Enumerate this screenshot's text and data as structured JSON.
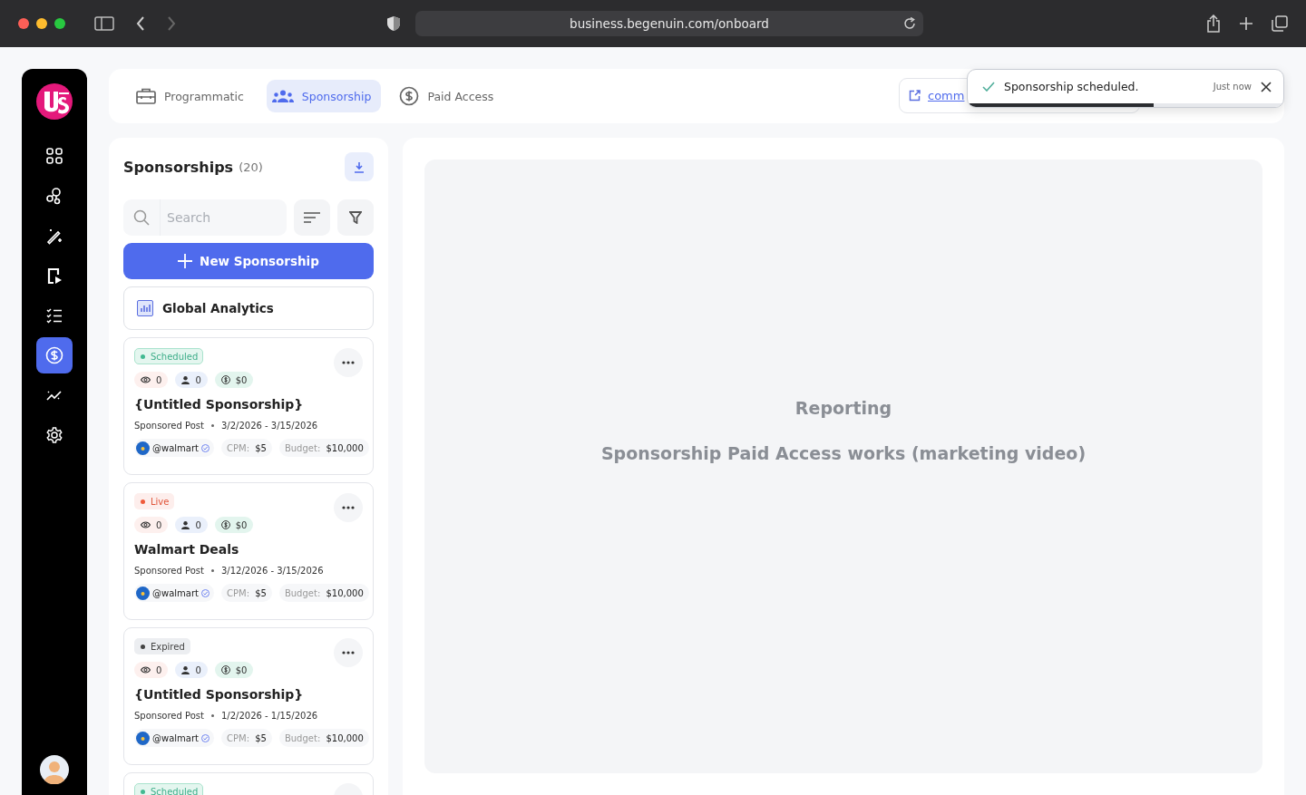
{
  "browser": {
    "url": "business.begenuin.com/onboard"
  },
  "sidebar": {
    "items": [
      {
        "selected": false
      },
      {
        "selected": false
      },
      {
        "selected": false
      },
      {
        "selected": false
      },
      {
        "selected": false
      },
      {
        "selected": true
      },
      {
        "selected": false
      },
      {
        "selected": false
      }
    ]
  },
  "tabs": [
    {
      "label": "Programmatic",
      "selected": false
    },
    {
      "label": "Sponsorship",
      "selected": true
    },
    {
      "label": "Paid Access",
      "selected": false
    }
  ],
  "link": {
    "text": "comm"
  },
  "toast": {
    "message": "Sponsorship scheduled.",
    "time": "Just now",
    "level": 0.59
  },
  "list": {
    "title": "Sponsorships",
    "count": "(20)",
    "search": {
      "placeholder": "Search"
    },
    "new_button": "New Sponsorship",
    "analytics": "Global Analytics",
    "cards": [
      {
        "status": {
          "kind": "scheduled",
          "label": "Scheduled"
        },
        "views": "0",
        "people": "0",
        "earnings": "$0",
        "title": "{Untitled Sponsorship}",
        "type": "Sponsored Post",
        "dates": "3/2/2026 - 3/15/2026",
        "handle": "@walmart",
        "verified": true,
        "cpm_label": "CPM:",
        "cpm": "$5",
        "budget_label": "Budget:",
        "budget": "$10,000"
      },
      {
        "status": {
          "kind": "live",
          "label": "Live"
        },
        "views": "0",
        "people": "0",
        "earnings": "$0",
        "title": "Walmart Deals",
        "type": "Sponsored Post",
        "dates": "3/12/2026 - 3/15/2026",
        "handle": "@walmart",
        "verified": true,
        "cpm_label": "CPM:",
        "cpm": "$5",
        "budget_label": "Budget:",
        "budget": "$10,000"
      },
      {
        "status": {
          "kind": "expired",
          "label": "Expired"
        },
        "views": "0",
        "people": "0",
        "earnings": "$0",
        "title": "{Untitled Sponsorship}",
        "type": "Sponsored Post",
        "dates": "1/2/2026 - 1/15/2026",
        "handle": "@walmart",
        "verified": true,
        "cpm_label": "CPM:",
        "cpm": "$5",
        "budget_label": "Budget:",
        "budget": "$10,000"
      },
      {
        "status": {
          "kind": "scheduled",
          "label": "Scheduled"
        }
      }
    ]
  },
  "main": {
    "title": "Reporting",
    "subtitle": "Sponsorship Paid Access works (marketing video)"
  }
}
